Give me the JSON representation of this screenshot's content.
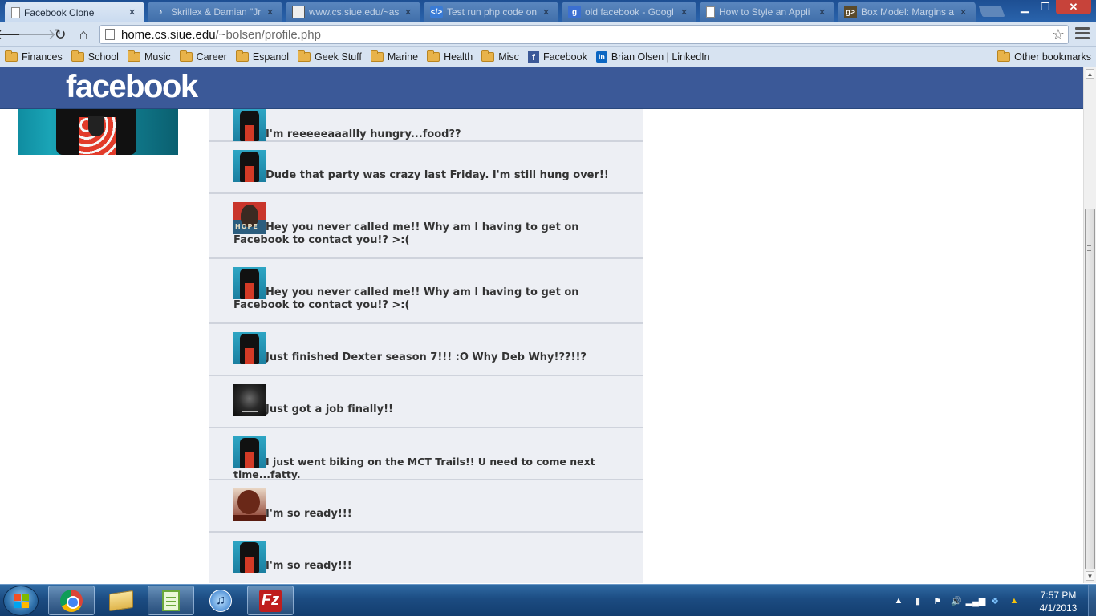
{
  "browser": {
    "tabs": [
      {
        "title": "Facebook Clone",
        "active": true,
        "icon": "page-icon"
      },
      {
        "title": "Skrillex & Damian \"Jr",
        "active": false,
        "icon": "music-icon"
      },
      {
        "title": "www.cs.siue.edu/~as",
        "active": false,
        "icon": "siue-icon"
      },
      {
        "title": "Test run php code on",
        "active": false,
        "icon": "code-icon"
      },
      {
        "title": "old facebook - Googl",
        "active": false,
        "icon": "google-icon"
      },
      {
        "title": "How to Style an Appli",
        "active": false,
        "icon": "page-icon"
      },
      {
        "title": "Box Model: Margins a",
        "active": false,
        "icon": "g-icon"
      }
    ],
    "url_host": "home.cs.siue.edu",
    "url_path": "/~bolsen/profile.php",
    "bookmarks": [
      {
        "label": "Finances",
        "type": "folder"
      },
      {
        "label": "School",
        "type": "folder"
      },
      {
        "label": "Music",
        "type": "folder"
      },
      {
        "label": "Career",
        "type": "folder"
      },
      {
        "label": "Espanol",
        "type": "folder"
      },
      {
        "label": "Geek Stuff",
        "type": "folder"
      },
      {
        "label": "Marine",
        "type": "folder"
      },
      {
        "label": "Health",
        "type": "folder"
      },
      {
        "label": "Misc",
        "type": "folder"
      },
      {
        "label": "Facebook",
        "type": "facebook"
      },
      {
        "label": "Brian Olsen | LinkedIn",
        "type": "linkedin"
      }
    ],
    "other_bookmarks": "Other bookmarks"
  },
  "page": {
    "logo": "facebook",
    "brand_color": "#3b5998",
    "posts": [
      {
        "avatar": "ninja",
        "text": "I'm reeeeeaaallly hungry...food??"
      },
      {
        "avatar": "ninja",
        "text": "Dude that party was crazy last Friday. I'm still hung over!!"
      },
      {
        "avatar": "hope",
        "text": "Hey you never called me!! Why am I having to get on Facebook to contact you!? >:("
      },
      {
        "avatar": "ninja",
        "text": "Hey you never called me!! Why am I having to get on Facebook to contact you!? >:("
      },
      {
        "avatar": "ninja",
        "text": "Just finished Dexter season 7!!! :O Why Deb Why!??!!?"
      },
      {
        "avatar": "dark",
        "text": "Just got a job finally!!"
      },
      {
        "avatar": "ninja",
        "text": "I just went biking on the MCT Trails!! U need to come next time...fatty."
      },
      {
        "avatar": "princess",
        "text": "I'm so ready!!!"
      },
      {
        "avatar": "ninja",
        "text": "I'm so ready!!!"
      }
    ]
  },
  "taskbar": {
    "apps": [
      "chrome",
      "explorer",
      "notepad++",
      "itunes",
      "filezilla"
    ],
    "time": "7:57 PM",
    "date": "4/1/2013"
  }
}
